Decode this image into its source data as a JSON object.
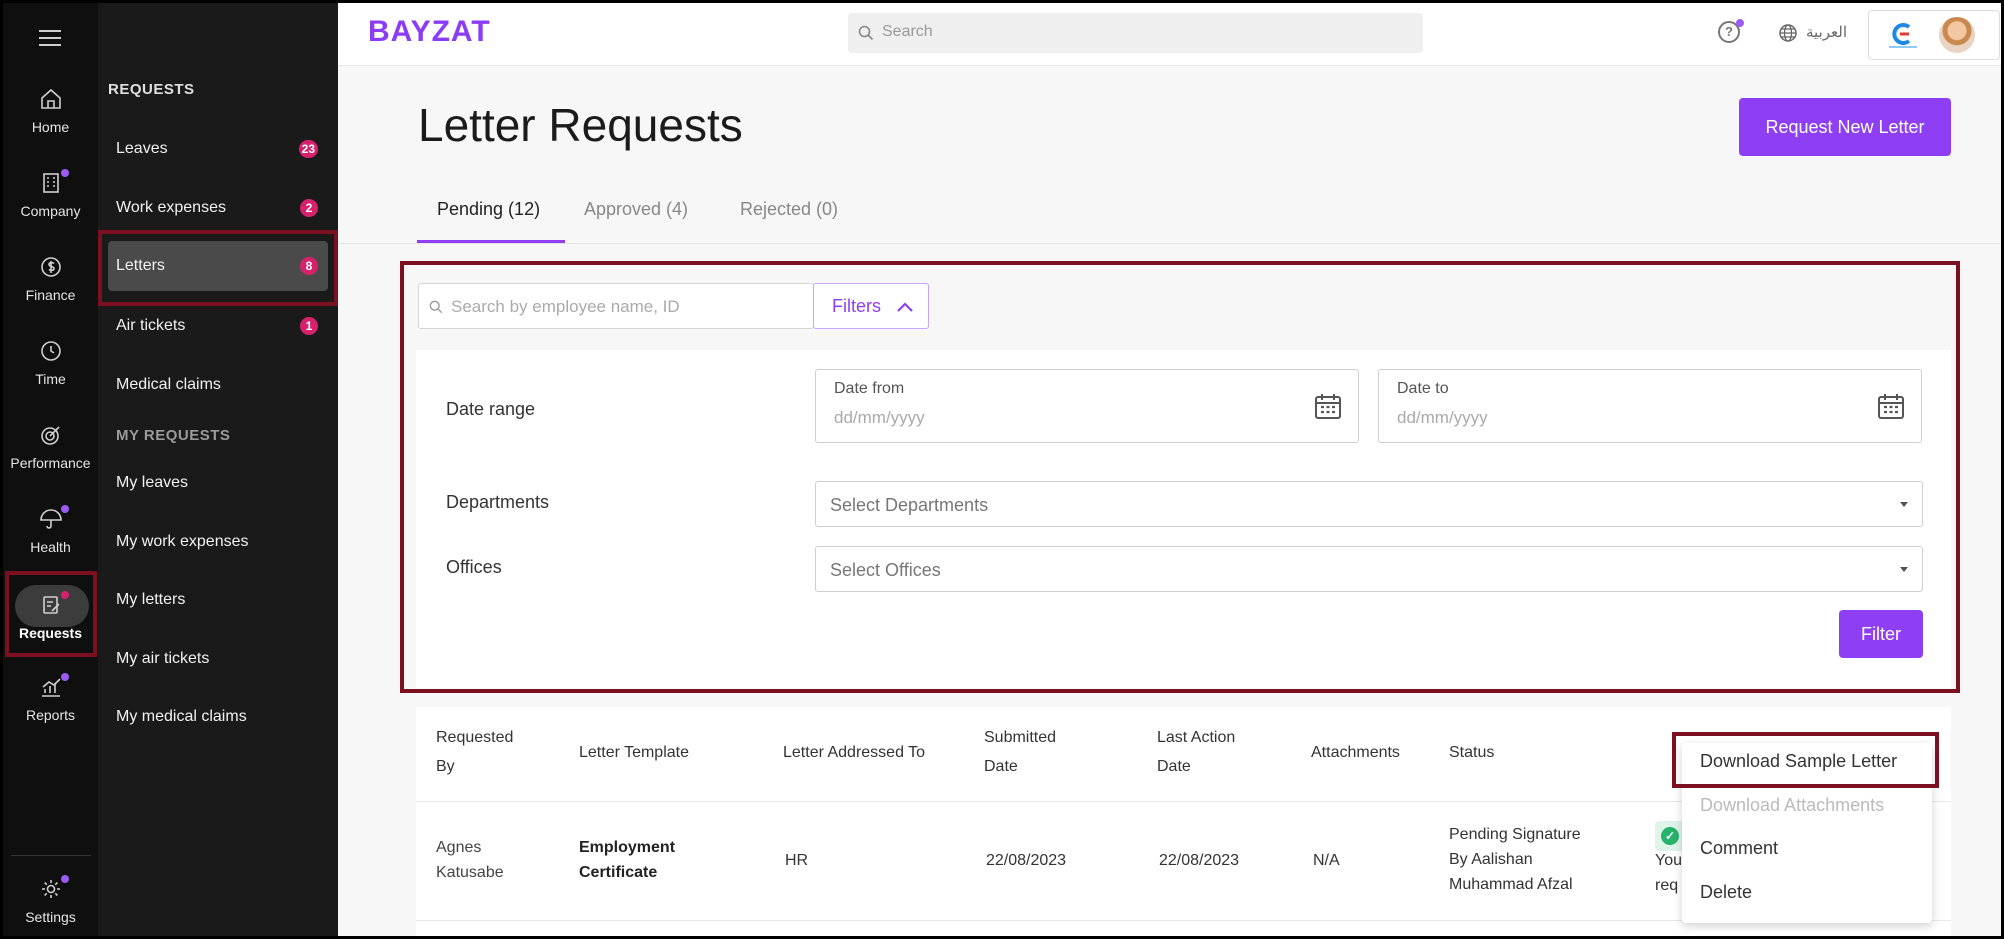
{
  "rail": {
    "items": [
      {
        "label": "Home"
      },
      {
        "label": "Company"
      },
      {
        "label": "Finance"
      },
      {
        "label": "Time"
      },
      {
        "label": "Performance"
      },
      {
        "label": "Health"
      },
      {
        "label": "Requests"
      },
      {
        "label": "Reports"
      },
      {
        "label": "Settings"
      }
    ]
  },
  "sidebar": {
    "requests_header": "REQUESTS",
    "items": [
      {
        "label": "Leaves",
        "count": "23"
      },
      {
        "label": "Work expenses",
        "count": "2"
      },
      {
        "label": "Letters",
        "count": "8"
      },
      {
        "label": "Air tickets",
        "count": "1"
      },
      {
        "label": "Medical claims"
      }
    ],
    "my_requests_header": "MY REQUESTS",
    "my_items": [
      {
        "label": "My leaves"
      },
      {
        "label": "My work expenses"
      },
      {
        "label": "My letters"
      },
      {
        "label": "My air tickets"
      },
      {
        "label": "My medical claims"
      }
    ]
  },
  "topbar": {
    "logo": "BAYZAT",
    "search_placeholder": "Search",
    "help": "?",
    "language": "العربية"
  },
  "page": {
    "title": "Letter Requests",
    "new_button": "Request New Letter",
    "tabs": [
      "Pending (12)",
      "Approved (4)",
      "Rejected (0)"
    ]
  },
  "filters": {
    "search_placeholder": "Search by employee name, ID",
    "filters_button": "Filters",
    "date_range_label": "Date range",
    "date_from_label": "Date from",
    "date_to_label": "Date to",
    "date_placeholder": "dd/mm/yyyy",
    "departments_label": "Departments",
    "departments_placeholder": "Select Departments",
    "offices_label": "Offices",
    "offices_placeholder": "Select Offices",
    "filter_button": "Filter"
  },
  "table": {
    "headers": {
      "requested_by_1": "Requested",
      "requested_by_2": "By",
      "template": "Letter Template",
      "addressed_to": "Letter Addressed To",
      "submitted_1": "Submitted",
      "submitted_2": "Date",
      "last_action_1": "Last Action",
      "last_action_2": "Date",
      "attachments": "Attachments",
      "status": "Status"
    },
    "row": {
      "name_1": "Agnes",
      "name_2": "Katusabe",
      "template_1": "Employment",
      "template_2": "Certificate",
      "addressed_to": "HR",
      "submitted": "22/08/2023",
      "last_action": "22/08/2023",
      "attachments": "N/A",
      "status_1": "Pending Signature",
      "status_2": "By Aalishan",
      "status_3": "Muhammad Afzal",
      "note_1": "You",
      "note_2": "req"
    }
  },
  "menu": {
    "items": [
      {
        "label": "Download Sample Letter",
        "enabled": true
      },
      {
        "label": "Download Attachments",
        "enabled": false
      },
      {
        "label": "Comment",
        "enabled": true
      },
      {
        "label": "Delete",
        "enabled": true
      }
    ]
  },
  "colors": {
    "accent": "#8f3ff3",
    "badge": "#d6226c",
    "highlight": "#7c1020"
  }
}
